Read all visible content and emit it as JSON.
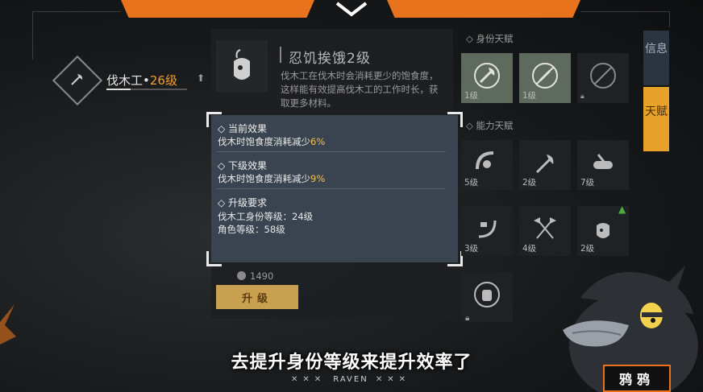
{
  "character": {
    "name": "伐木工",
    "separator": "•",
    "level": "26级"
  },
  "skill": {
    "title": "忍饥挨饿2级",
    "description": "伐木工在伐木时会消耗更少的饱食度，这样能有效提高伐木工的工作时长，获取更多材料。"
  },
  "tooltip": {
    "current_header": "◇ 当前效果",
    "current_text": "伐木时饱食度消耗减少",
    "current_value": "6%",
    "next_header": "◇ 下级效果",
    "next_text": "伐木时饱食度消耗减少",
    "next_value": "9%",
    "req_header": "◇ 升级要求",
    "req_line1": "伐木工身份等级：24级",
    "req_line2": "角色等级：58级"
  },
  "cost": "1490",
  "upgrade_label": "升级",
  "talents": {
    "identity_label": "◇ 身份天赋",
    "ability_label": "◇ 能力天赋",
    "identity": [
      {
        "icon": "axe-icon",
        "level": "1级",
        "owned": true
      },
      {
        "icon": "axe-restrict-icon",
        "level": "1级",
        "owned": true
      },
      {
        "icon": "locked-talent-icon",
        "level": "",
        "owned": false,
        "locked": true
      }
    ],
    "ability": [
      {
        "icon": "swing-icon",
        "level": "5级"
      },
      {
        "icon": "chop-icon",
        "level": "2级"
      },
      {
        "icon": "log-icon",
        "level": "7级"
      },
      {
        "icon": "hammer-swing-icon",
        "level": "3级"
      },
      {
        "icon": "crossed-axes-icon",
        "level": "4级"
      },
      {
        "icon": "hunger-icon",
        "level": "2级"
      }
    ]
  },
  "side_tabs": {
    "info": "信息",
    "talent": "天赋"
  },
  "subtitle": "去提升身份等级来提升效率了",
  "watermark": "RAVEN",
  "mascot_name": "鸦鸦",
  "colors": {
    "accent": "#e8731c",
    "tooltip_bg": "#3a4450",
    "value_highlight": "#f2c14a",
    "upgrade_button": "#c8a050"
  }
}
